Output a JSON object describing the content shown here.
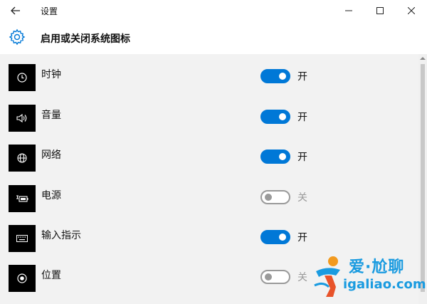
{
  "window": {
    "title": "设置",
    "minimize_icon": "minimize-icon",
    "maximize_icon": "maximize-icon",
    "close_icon": "close-icon"
  },
  "header": {
    "title": "启用或关闭系统图标",
    "icon": "gear-icon"
  },
  "accent_color": "#0078d7",
  "items": [
    {
      "label": "时钟",
      "icon": "clock-icon",
      "enabled": true,
      "state": "开"
    },
    {
      "label": "音量",
      "icon": "volume-icon",
      "enabled": true,
      "state": "开"
    },
    {
      "label": "网络",
      "icon": "globe-icon",
      "enabled": true,
      "state": "开"
    },
    {
      "label": "电源",
      "icon": "battery-icon",
      "enabled": false,
      "state": "关"
    },
    {
      "label": "输入指示",
      "icon": "keyboard-icon",
      "enabled": true,
      "state": "开"
    },
    {
      "label": "位置",
      "icon": "location-icon",
      "enabled": false,
      "state": "关"
    }
  ],
  "watermark": {
    "name": "爱·尬聊",
    "url": "igaliao.com"
  }
}
